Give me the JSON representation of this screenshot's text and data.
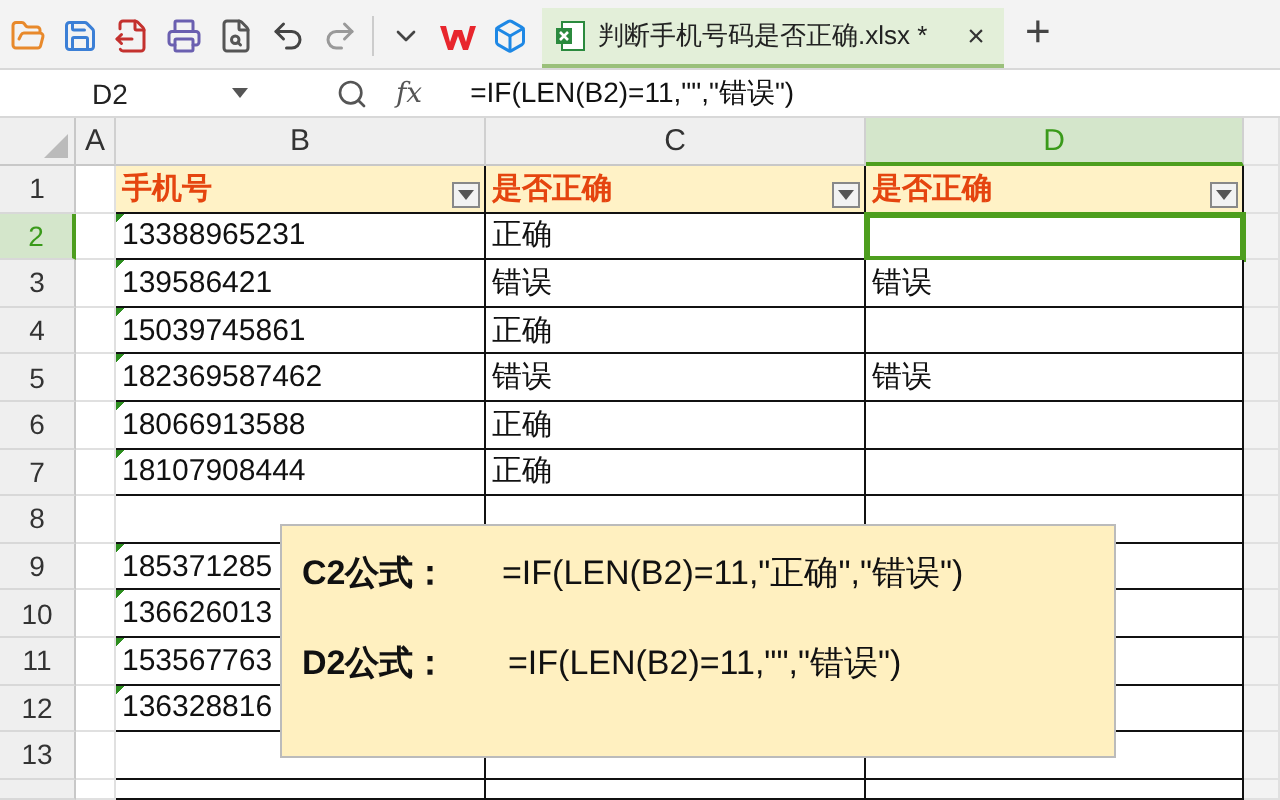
{
  "toolbar": {
    "document_tab": {
      "title": "判断手机号码是否正确.xlsx *",
      "close": "×",
      "selected": true
    },
    "new_tab": "+"
  },
  "formula_bar": {
    "cell_ref": "D2",
    "fx": "fx",
    "formula": "=IF(LEN(B2)=11,\"\",\"错误\")"
  },
  "sheet": {
    "columns": [
      {
        "label": "A",
        "selected": false
      },
      {
        "label": "B",
        "selected": false
      },
      {
        "label": "C",
        "selected": false
      },
      {
        "label": "D",
        "selected": true
      }
    ],
    "rows": [
      {
        "number": "1",
        "kind": "header",
        "selected": false,
        "b": "手机号",
        "c": "是否正确",
        "d": "是否正确"
      },
      {
        "number": "2",
        "kind": "data",
        "selected": true,
        "b": "13388965231",
        "c": "正确"
      },
      {
        "number": "3",
        "kind": "data",
        "selected": false,
        "b": "139586421",
        "c": "错误",
        "d": "错误"
      },
      {
        "number": "4",
        "kind": "data",
        "selected": false,
        "b": "15039745861",
        "c": "正确"
      },
      {
        "number": "5",
        "kind": "data",
        "selected": false,
        "b": "182369587462",
        "c": "错误",
        "d": "错误"
      },
      {
        "number": "6",
        "kind": "data",
        "selected": false,
        "b": "18066913588",
        "c": "正确"
      },
      {
        "number": "7",
        "kind": "data",
        "selected": false,
        "b": "18107908444",
        "c": "正确"
      },
      {
        "number": "8",
        "kind": "data",
        "selected": false
      },
      {
        "number": "9",
        "kind": "data",
        "selected": false,
        "b": "185371285"
      },
      {
        "number": "10",
        "kind": "data",
        "selected": false,
        "b": "136626013"
      },
      {
        "number": "11",
        "kind": "data",
        "selected": false,
        "b": "153567763"
      },
      {
        "number": "12",
        "kind": "data",
        "selected": false,
        "b": "136328816"
      },
      {
        "number": "13",
        "kind": "data",
        "selected": false
      }
    ]
  },
  "note": {
    "lines": [
      {
        "label": "C2公式：",
        "formula": "=IF(LEN(B2)=11,\"正确\",\"错误\")"
      },
      {
        "label": "D2公式：",
        "formula": "=IF(LEN(B2)=11,\"\",\"错误\")"
      }
    ]
  }
}
